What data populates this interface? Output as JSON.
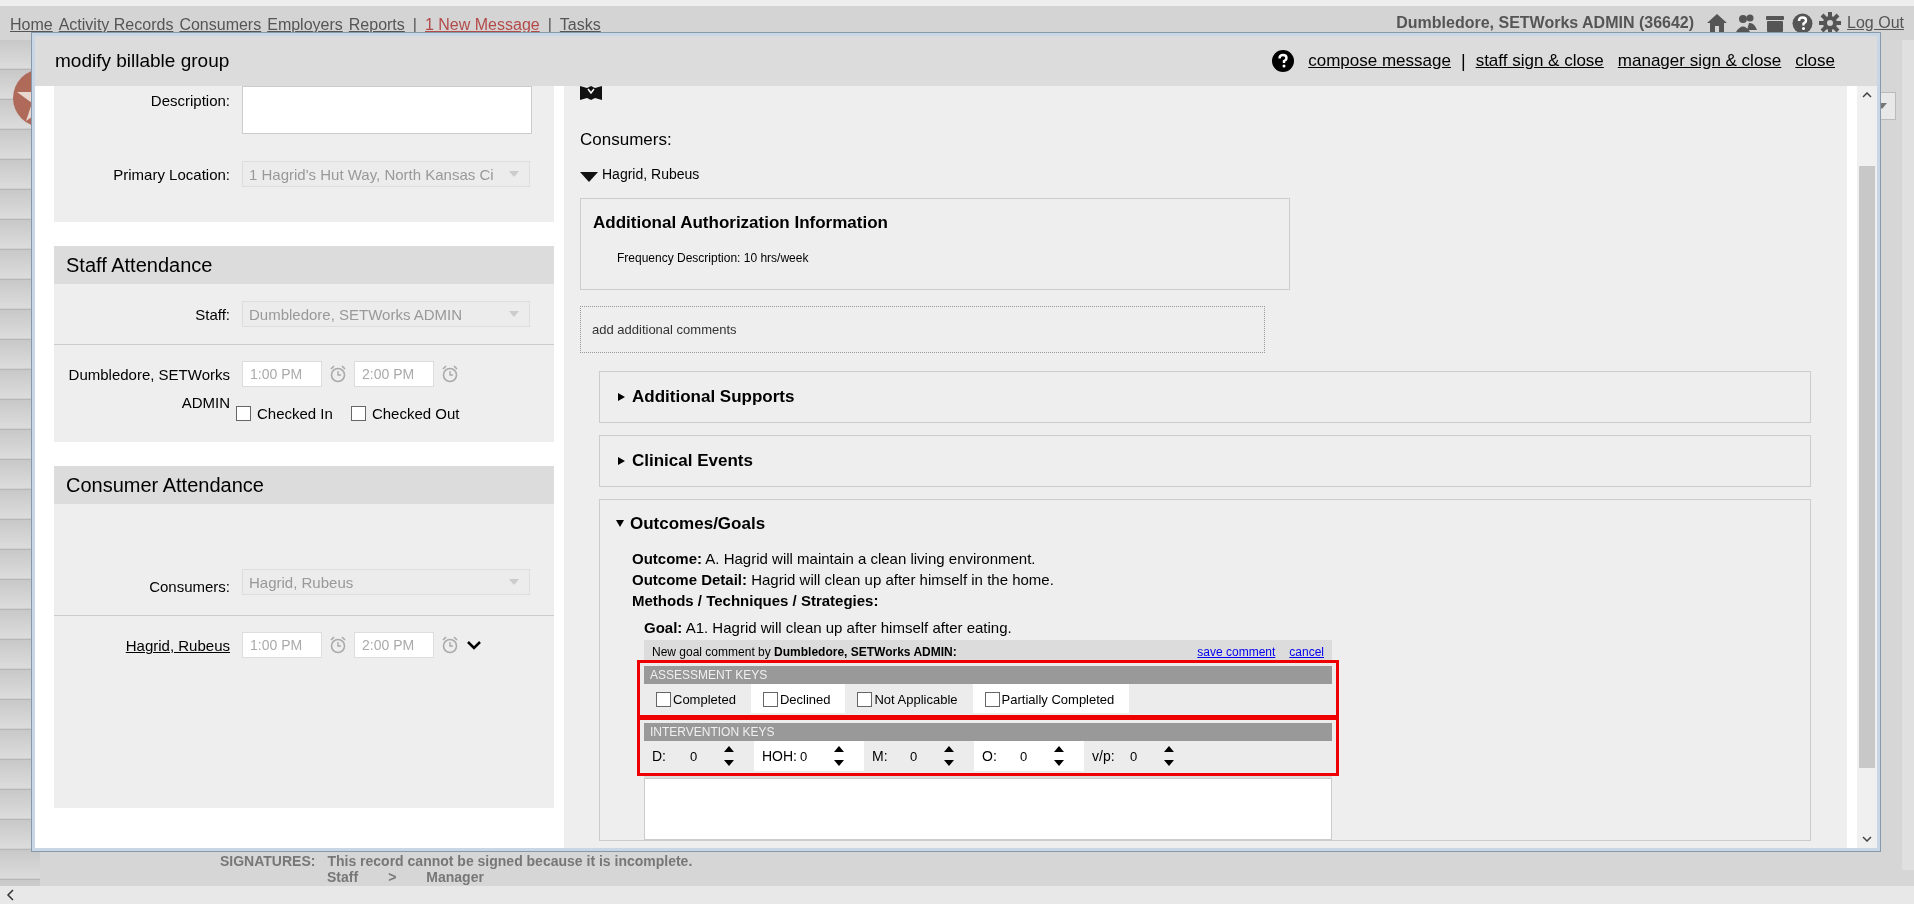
{
  "nav": {
    "items": [
      {
        "kind": "link",
        "label": "Home"
      },
      {
        "kind": "link",
        "label": "Activity Records"
      },
      {
        "kind": "link",
        "label": "Consumers"
      },
      {
        "kind": "link",
        "label": "Employers"
      },
      {
        "kind": "link",
        "label": "Reports"
      },
      {
        "kind": "separator",
        "label": "|"
      },
      {
        "kind": "alert",
        "label": "1 New Message"
      },
      {
        "kind": "separator",
        "label": "|"
      },
      {
        "kind": "link",
        "label": "Tasks"
      }
    ],
    "user": "Dumbledore, SETWorks ADMIN  (36642)",
    "logout": "Log Out"
  },
  "background": {
    "signatures_label": "SIGNATURES:",
    "signatures_text": "This record cannot be signed because it is incomplete.",
    "steps": [
      "Staff",
      ">",
      "Manager"
    ]
  },
  "modal": {
    "title": "modify billable group",
    "actions": [
      {
        "kind": "link",
        "label": "compose message"
      },
      {
        "kind": "separator",
        "label": "|"
      },
      {
        "kind": "link",
        "label": "staff sign & close"
      },
      {
        "kind": "link",
        "label": "manager sign & close"
      },
      {
        "kind": "link",
        "label": "close"
      }
    ],
    "details": {
      "description_label": "Description:",
      "location_label": "Primary Location:",
      "location_value": "1 Hagrid's Hut Way, North Kansas Ci"
    },
    "staff_attendance": {
      "title": "Staff Attendance",
      "select_label": "Staff:",
      "select_value": "Dumbledore, SETWorks ADMIN",
      "rows": [
        {
          "name": "Dumbledore, SETWorks ADMIN",
          "start": "1:00 PM",
          "end": "2:00 PM",
          "checks": [
            {
              "label": "Checked In",
              "checked": false
            },
            {
              "label": "Checked Out",
              "checked": false
            }
          ]
        }
      ]
    },
    "consumer_attendance": {
      "title": "Consumer Attendance",
      "select_label": "Consumers:",
      "select_value": "Hagrid, Rubeus",
      "rows": [
        {
          "name": "Hagrid, Rubeus",
          "start": "1:00 PM",
          "end": "2:00 PM"
        }
      ]
    },
    "right": {
      "consumers_label": "Consumers:",
      "consumer": {
        "name": "Hagrid, Rubeus",
        "expanded": true
      },
      "auth": {
        "title": "Additional Authorization Information",
        "text": "Frequency Description: 10 hrs/week"
      },
      "comments_placeholder": "add additional comments",
      "sections": [
        {
          "title": "Additional Supports",
          "expanded": false
        },
        {
          "title": "Clinical Events",
          "expanded": false
        },
        {
          "title": "Outcomes/Goals",
          "expanded": true
        }
      ],
      "outcome": {
        "lines": [
          "**Outcome:** A. Hagrid will maintain a clean living environment.",
          "**Outcome Detail:** Hagrid will clean up after himself in the home.",
          "**Methods / Techniques / Strategies:**"
        ],
        "goal": "**Goal:** A1. Hagrid will clean up after himself after eating.",
        "comment_header": "New goal comment by **Dumbledore, SETWorks ADMIN:**",
        "save": "save comment",
        "cancel": "cancel",
        "assessment_title": "ASSESSMENT KEYS",
        "assessment": [
          {
            "label": "Completed",
            "checked": false
          },
          {
            "label": "Declined",
            "checked": false
          },
          {
            "label": "Not Applicable",
            "checked": false
          },
          {
            "label": "Partially Completed",
            "checked": false
          }
        ],
        "intervention_title": "INTERVENTION KEYS",
        "intervention": [
          {
            "label": "D:",
            "value": "0"
          },
          {
            "label": "HOH:",
            "value": "0"
          },
          {
            "label": "M:",
            "value": "0"
          },
          {
            "label": "O:",
            "value": "0"
          },
          {
            "label": "v/p:",
            "value": "0"
          }
        ]
      }
    }
  }
}
